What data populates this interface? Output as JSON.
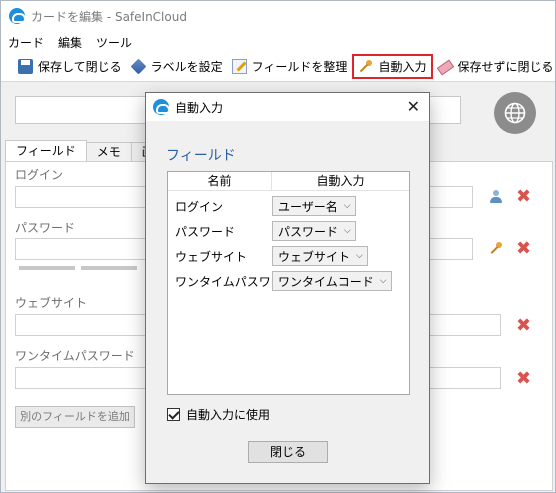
{
  "window": {
    "title": "カードを編集 - SafeInCloud"
  },
  "menu": [
    "カード",
    "編集",
    "ツール"
  ],
  "toolbar": {
    "save_close": "保存して閉じる",
    "set_label": "ラベルを設定",
    "organize_fields": "フィールドを整理",
    "autofill": "自動入力",
    "close_without_save": "保存せずに閉じる"
  },
  "tabs": [
    "フィールド",
    "メモ",
    "画像"
  ],
  "fields": {
    "login_label": "ログイン",
    "password_label": "パスワード",
    "website_label": "ウェブサイト",
    "otp_label": "ワンタイムパスワード",
    "add_field_button": "別のフィールドを追加"
  },
  "dialog": {
    "title": "自動入力",
    "section_heading": "フィールド",
    "col_name": "名前",
    "col_autofill": "自動入力",
    "rows": [
      {
        "name": "ログイン",
        "value": "ユーザー名"
      },
      {
        "name": "パスワード",
        "value": "パスワード"
      },
      {
        "name": "ウェブサイト",
        "value": "ウェブサイト"
      },
      {
        "name": "ワンタイムパスワー",
        "value": "ワンタイムコード"
      }
    ],
    "use_autofill_label": "自動入力に使用",
    "use_autofill_checked": true,
    "close_button": "閉じる"
  },
  "colors": {
    "accent": "#2a5fa3",
    "highlight_border": "#e0242b",
    "delete": "#d9534f"
  }
}
